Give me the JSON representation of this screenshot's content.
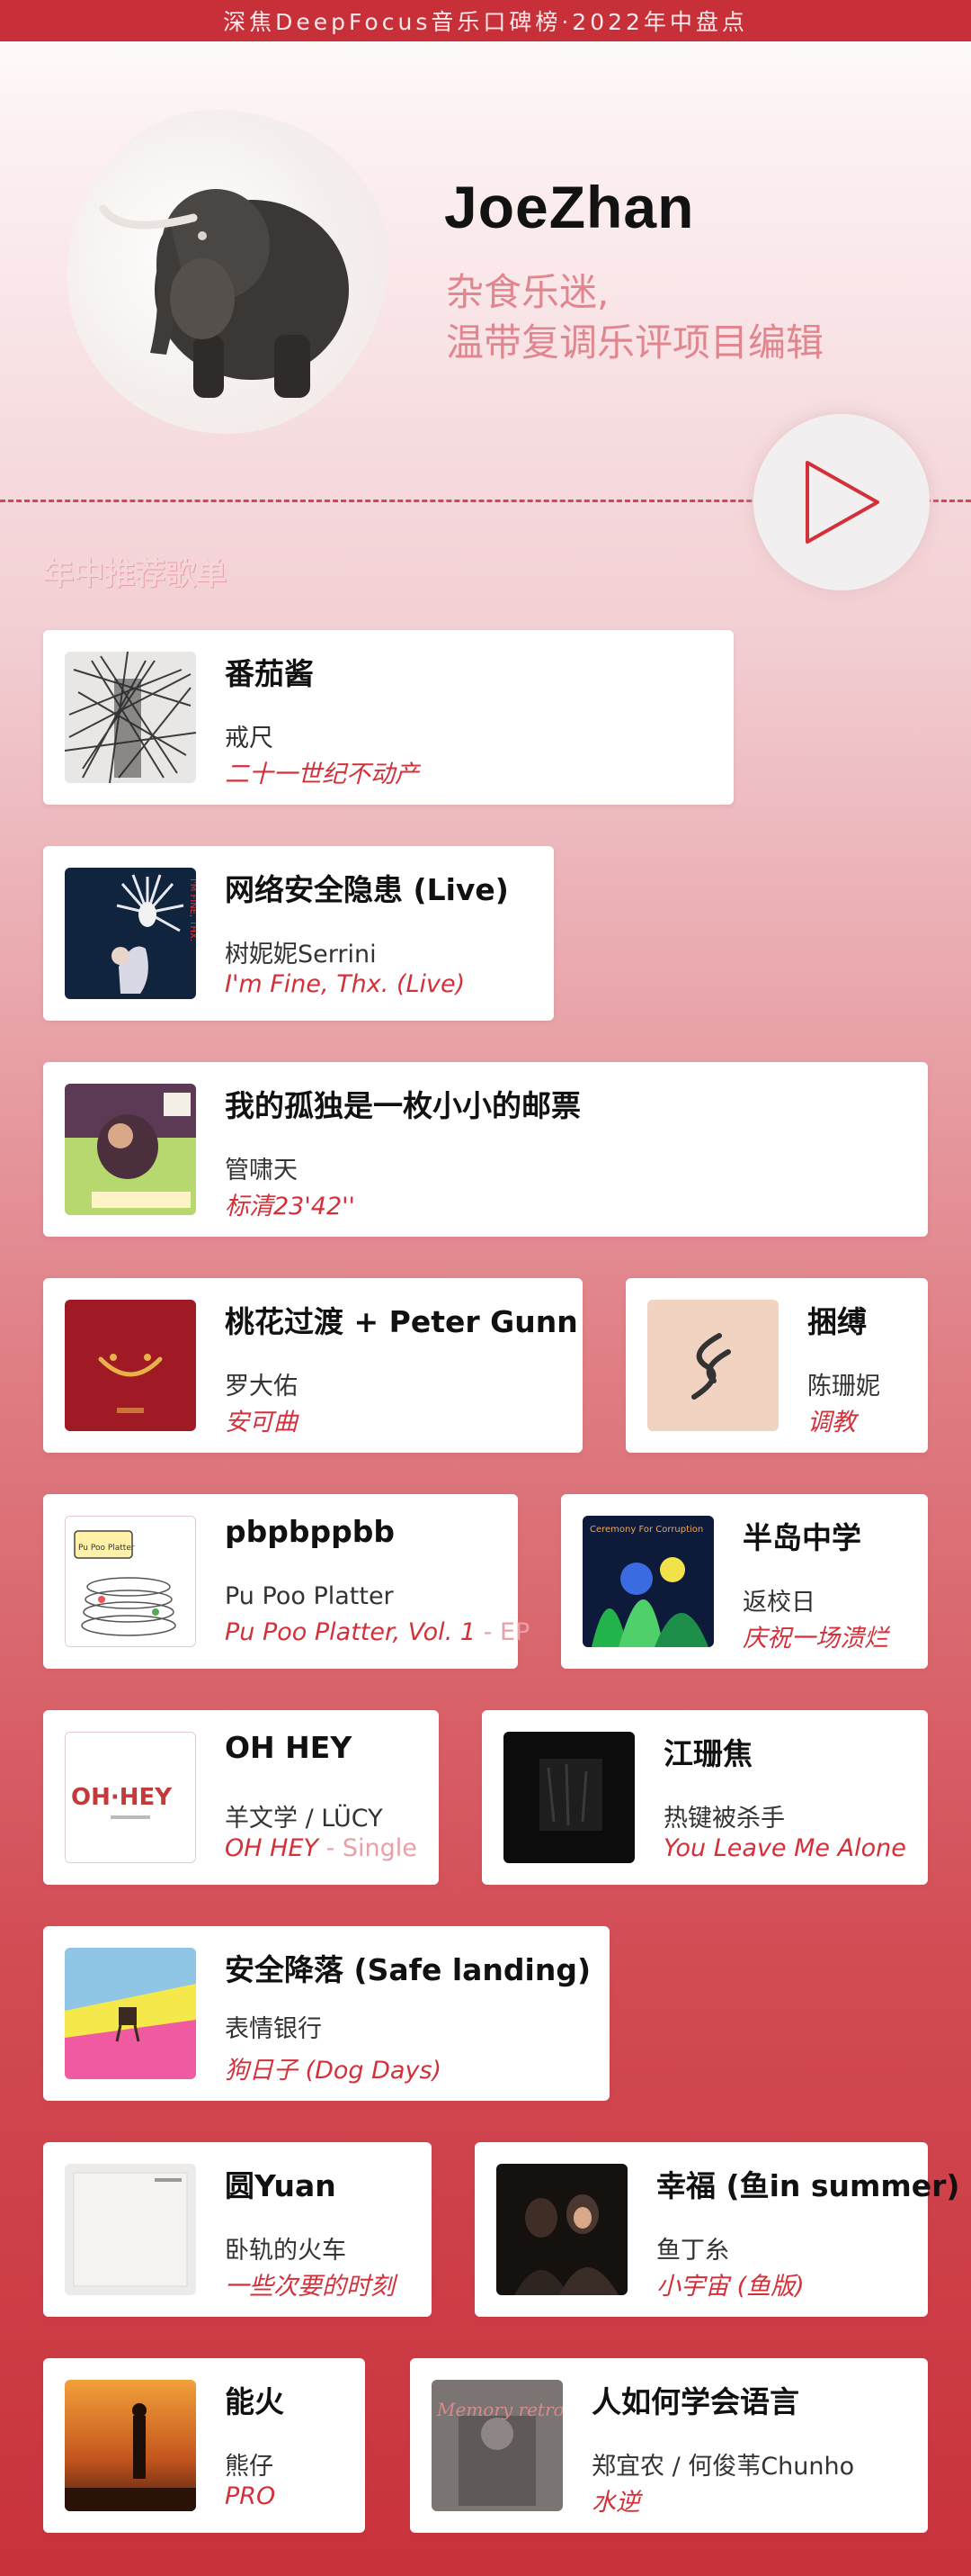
{
  "header": {
    "banner_text": "深焦DeepFocus音乐口碑榜·2022年中盘点"
  },
  "profile": {
    "name": "JoeZhan",
    "bio_line1": "杂食乐迷,",
    "bio_line2": "温带复调乐评项目编辑",
    "avatar_icon": "elephant-photo",
    "play_icon": "play-icon"
  },
  "section": {
    "title": "年中推荐歌单"
  },
  "colors": {
    "accent": "#c72f39",
    "album_text": "#d4303a",
    "bio_text": "#e0868e"
  },
  "tracks": [
    {
      "song": "番茄酱",
      "artist": "戒尺",
      "album": "二十一世纪不动产",
      "album_suffix": ""
    },
    {
      "song": "网络安全隐患 (Live)",
      "artist": "树妮妮Serrini",
      "album": "I'm Fine, Thx. (Live)",
      "album_suffix": ""
    },
    {
      "song": "我的孤独是一枚小小的邮票",
      "artist": "管啸天",
      "album": "标清23'42''",
      "album_suffix": ""
    },
    {
      "song": "桃花过渡 + Peter Gunn",
      "artist": "罗大佑",
      "album": "安可曲",
      "album_suffix": ""
    },
    {
      "song": "捆缚",
      "artist": "陈珊妮",
      "album": "调教",
      "album_suffix": ""
    },
    {
      "song": "pbpbppbb",
      "artist": "Pu Poo Platter",
      "album": "Pu Poo Platter, Vol. 1",
      "album_suffix": " - EP"
    },
    {
      "song": "半岛中学",
      "artist": "返校日",
      "album": "庆祝一场溃烂",
      "album_suffix": ""
    },
    {
      "song": "OH HEY",
      "artist": "羊文学 / LÜCY",
      "album": "OH HEY",
      "album_suffix": " - Single"
    },
    {
      "song": "江珊焦",
      "artist": "热键被杀手",
      "album": "You Leave Me Alone",
      "album_suffix": ""
    },
    {
      "song": "安全降落 (Safe landing)",
      "artist": "表情银行",
      "album": "狗日子 (Dog Days)",
      "album_suffix": ""
    },
    {
      "song": "圆Yuan",
      "artist": "卧轨的火车",
      "album": "一些次要的时刻",
      "album_suffix": ""
    },
    {
      "song": "幸福 (鱼in summer)",
      "artist": "鱼丁糸",
      "album": "小宇宙 (鱼版)",
      "album_suffix": ""
    },
    {
      "song": "能火",
      "artist": "熊仔",
      "album": "PRO",
      "album_suffix": ""
    },
    {
      "song": "人如何学会语言",
      "artist": "郑宜农 / 何俊苇Chunho",
      "album": "水逆",
      "album_suffix": ""
    }
  ],
  "cover_art": {
    "t0": "OH·HEY",
    "t1": "Pu Poo Platter",
    "t2": "I'M FINE, THX.",
    "t3": "Ceremony For Corruption",
    "t4": "Memory retro made"
  }
}
